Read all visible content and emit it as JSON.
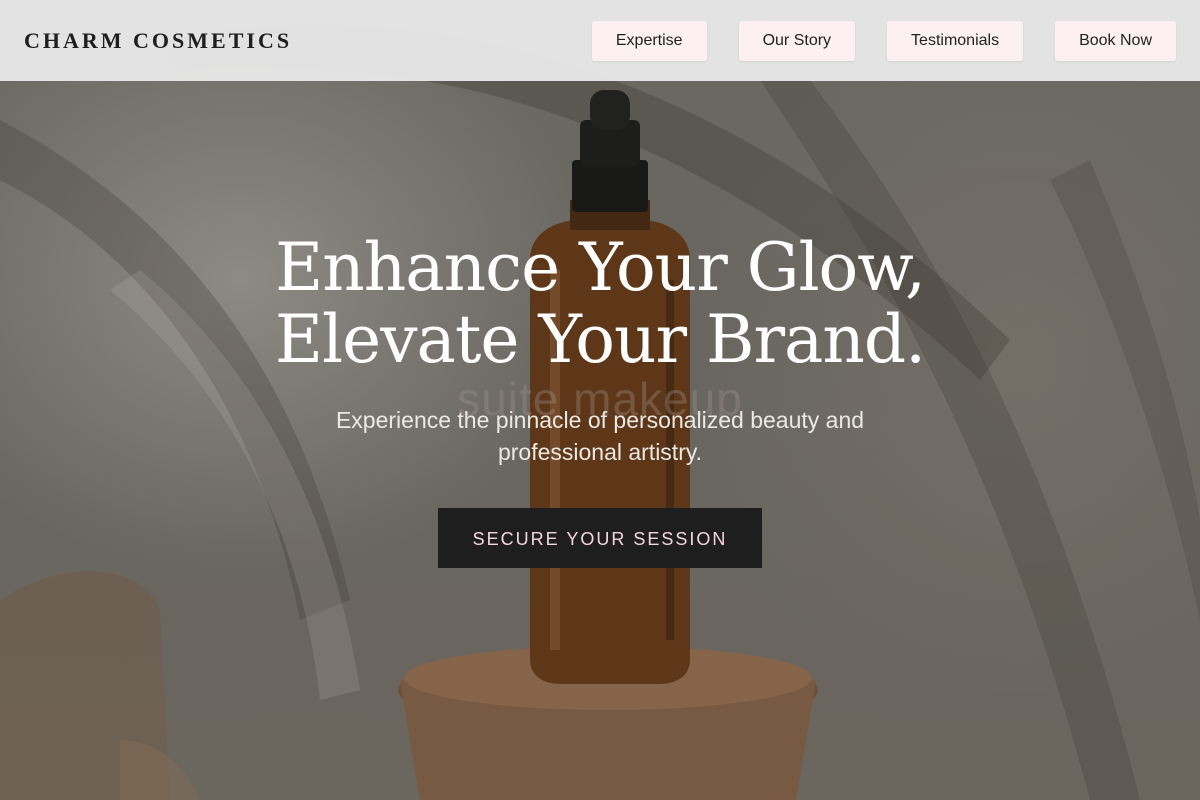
{
  "header": {
    "logo": "CHARM COSMETICS",
    "nav": [
      {
        "label": "Expertise"
      },
      {
        "label": "Our Story"
      },
      {
        "label": "Testimonials"
      },
      {
        "label": "Book Now"
      }
    ]
  },
  "hero": {
    "headline_line1": "Enhance Your Glow,",
    "headline_line2": "Elevate Your Brand.",
    "subtitle": "Experience the pinnacle of personalized beauty and professional artistry.",
    "cta_label": "SECURE YOUR SESSION",
    "background_watermark": "suite makeup"
  },
  "colors": {
    "nav_button_bg": "#fdf0f2",
    "cta_bg": "#1e1e1f",
    "cta_text": "#f6d6de",
    "header_bg": "#e8e8e8",
    "headline": "#ffffff"
  },
  "images": {
    "hero_background": "amber-dropper-bottle-on-wooden-pedestal-photo"
  }
}
